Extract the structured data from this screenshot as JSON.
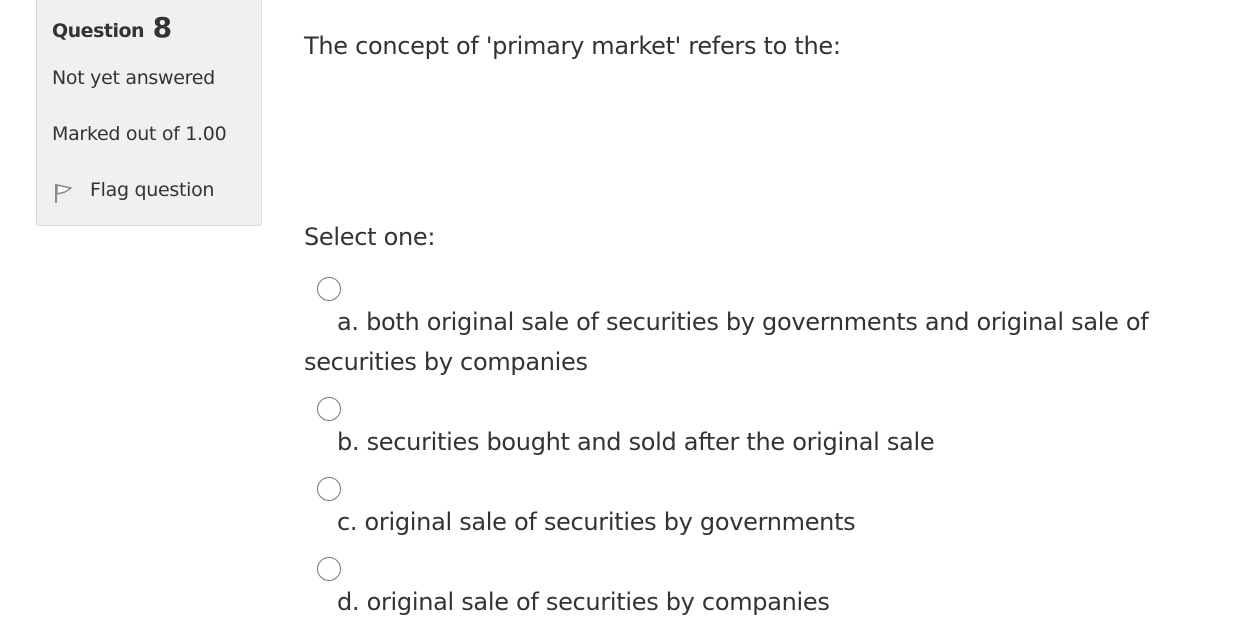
{
  "info": {
    "question_word": "Question",
    "question_number": "8",
    "state": "Not yet answered",
    "grade": "Marked out of 1.00",
    "flag_label": "Flag question"
  },
  "question": {
    "text": "The concept of 'primary market' refers to the:",
    "prompt": "Select one:",
    "options": [
      {
        "label": "a. both original sale of securities by governments and original sale of securities by companies",
        "selected": false
      },
      {
        "label": "b. securities bought and sold after the original sale",
        "selected": false
      },
      {
        "label": "c. original sale of securities by governments",
        "selected": false
      },
      {
        "label": "d. original sale of securities by companies",
        "selected": false
      }
    ]
  },
  "icons": {
    "flag": "flag-icon",
    "radio": "radio-unchecked-icon"
  }
}
